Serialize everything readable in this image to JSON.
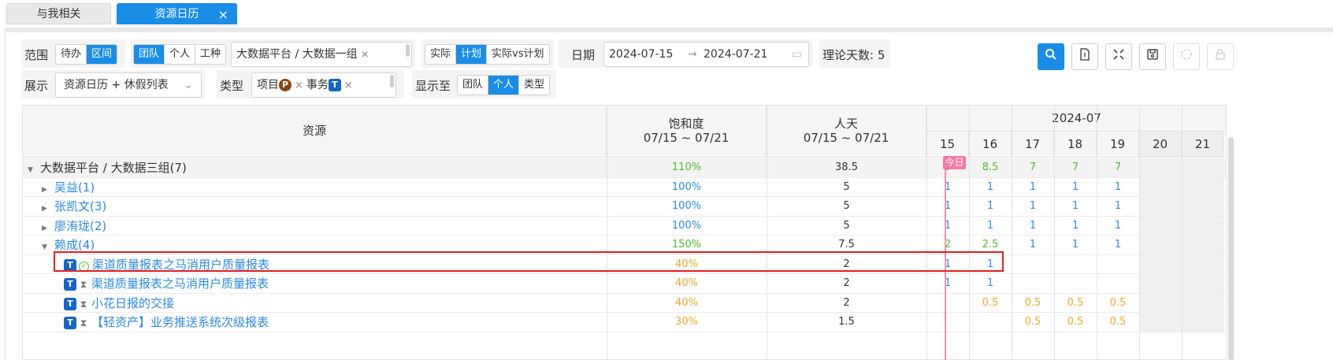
{
  "tabs": [
    {
      "label": "与我相关",
      "active": false
    },
    {
      "label": "资源日历",
      "active": true
    }
  ],
  "tab_close": "×",
  "filters": {
    "scope_label": "范围",
    "scope_options": [
      "待办",
      "区间"
    ],
    "team_options": [
      "团队",
      "个人",
      "工种"
    ],
    "team_value": "大数据平台 / 大数据一组",
    "clear": "×",
    "mode_options": [
      "实际",
      "计划",
      "实际vs计划"
    ],
    "date_label": "日期",
    "date_start": "2024-07-15",
    "date_arrow": "→",
    "date_end": "2024-07-21",
    "days_label": "理论天数: 5",
    "display_label": "展示",
    "display_value": "资源日历 + 休假列表",
    "type_label": "类型",
    "type_chip1": "项目",
    "type_chip1_badge": "P",
    "type_chip2": "事务",
    "type_chip2_badge": "T",
    "show_label": "显示至",
    "show_options": [
      "团队",
      "个人",
      "类型"
    ]
  },
  "toolbar": [
    "search-icon",
    "export-file-icon",
    "fullscreen-icon",
    "save-icon",
    "loading-icon",
    "lock-icon"
  ],
  "grid": {
    "col_resource": "资源",
    "col_saturation": "饱和度",
    "col_saturation_range": "07/15 ~ 07/21",
    "col_mandays": "人天",
    "col_mandays_range": "07/15 ~ 07/21",
    "month": "2024-07",
    "days": [
      "15",
      "16",
      "17",
      "18",
      "19",
      "20",
      "21"
    ],
    "today_tag": "今日",
    "rows": [
      {
        "name": "大数据平台 / 大数据三组(7)",
        "sat": "110%",
        "md": "38.5",
        "d": [
          "9",
          "8.5",
          "7",
          "7",
          "7",
          "",
          ""
        ],
        "type": "group"
      },
      {
        "name": "吴益(1)",
        "sat": "100%",
        "md": "5",
        "d": [
          "1",
          "1",
          "1",
          "1",
          "1",
          "",
          ""
        ],
        "type": "person"
      },
      {
        "name": "张凯文(3)",
        "sat": "100%",
        "md": "5",
        "d": [
          "1",
          "1",
          "1",
          "1",
          "1",
          "",
          ""
        ],
        "type": "person"
      },
      {
        "name": "廖洧珑(2)",
        "sat": "100%",
        "md": "5",
        "d": [
          "1",
          "1",
          "1",
          "1",
          "1",
          "",
          ""
        ],
        "type": "person"
      },
      {
        "name": "赖成(4)",
        "sat": "150%",
        "md": "7.5",
        "d": [
          "2",
          "2.5",
          "1",
          "1",
          "1",
          "",
          ""
        ],
        "type": "person-open"
      },
      {
        "name": "渠道质量报表之马消用户质量报表",
        "sat": "40%",
        "md": "2",
        "d": [
          "1",
          "1",
          "",
          "",
          "",
          "",
          ""
        ],
        "type": "task-done"
      },
      {
        "name": "渠道质量报表之马消用户质量报表",
        "sat": "40%",
        "md": "2",
        "d": [
          "1",
          "1",
          "",
          "",
          "",
          "",
          ""
        ],
        "type": "task"
      },
      {
        "name": "小花日报的交接",
        "sat": "40%",
        "md": "2",
        "d": [
          "",
          "0.5",
          "0.5",
          "0.5",
          "0.5",
          "",
          ""
        ],
        "type": "task"
      },
      {
        "name": "【轻资产】业务推送系统次级报表",
        "sat": "30%",
        "md": "1.5",
        "d": [
          "",
          "",
          "0.5",
          "0.5",
          "0.5",
          "",
          ""
        ],
        "type": "task"
      }
    ]
  }
}
